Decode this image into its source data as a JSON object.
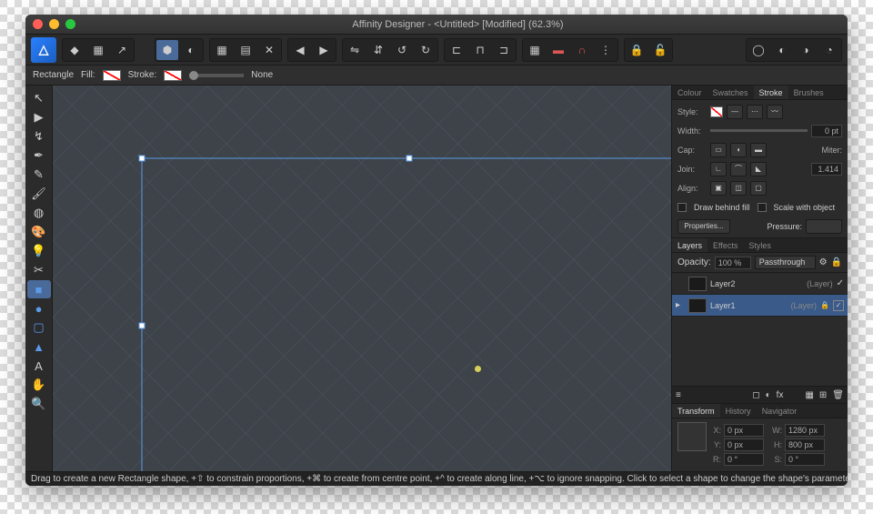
{
  "window": {
    "title": "Affinity Designer - <Untitled> [Modified] (62.3%)"
  },
  "context": {
    "shape": "Rectangle",
    "fill_label": "Fill:",
    "stroke_label": "Stroke:",
    "stroke_value": "None"
  },
  "tools": [
    "arrow",
    "move",
    "node",
    "pen",
    "pencil",
    "brush",
    "fill",
    "color",
    "light",
    "crop",
    "rect",
    "ellipse",
    "rrect",
    "triangle",
    "text",
    "hand",
    "zoom"
  ],
  "stroke_panel": {
    "tabs": [
      "Colour",
      "Swatches",
      "Stroke",
      "Brushes"
    ],
    "style_label": "Style:",
    "width_label": "Width:",
    "width": "0 pt",
    "cap_label": "Cap:",
    "miter_label": "Miter:",
    "miter": "1.414",
    "join_label": "Join:",
    "align_label": "Align:",
    "draw_behind": "Draw behind fill",
    "scale_obj": "Scale with object",
    "properties": "Properties...",
    "pressure": "Pressure:"
  },
  "layers_panel": {
    "tabs": [
      "Layers",
      "Effects",
      "Styles"
    ],
    "opacity_label": "Opacity:",
    "opacity": "100 %",
    "blend": "Passthrough",
    "items": [
      {
        "name": "Layer2",
        "type": "(Layer)",
        "selected": false,
        "locked": false
      },
      {
        "name": "Layer1",
        "type": "(Layer)",
        "selected": true,
        "locked": true
      }
    ]
  },
  "transform": {
    "tabs": [
      "Transform",
      "History",
      "Navigator"
    ],
    "x": "0 px",
    "y": "0 px",
    "w": "1280 px",
    "h": "800 px",
    "r": "0 °",
    "s": "0 °",
    "labels": {
      "x": "X:",
      "y": "Y:",
      "w": "W:",
      "h": "H:",
      "r": "R:",
      "s": "S:"
    }
  },
  "status": "Drag to create a new Rectangle shape, +⇧ to constrain proportions, +⌘ to create from centre point, +^ to create along line, +⌥ to ignore snapping. Click to select a shape to change the shape's parameters, +⇧ to toggle select."
}
